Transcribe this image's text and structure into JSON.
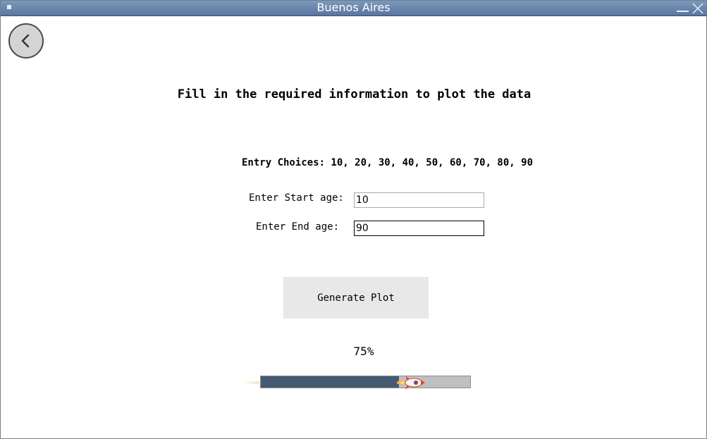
{
  "window": {
    "title": "Buenos Aires"
  },
  "titlebar_icons": [
    "window-menu-icon",
    "minimize-icon",
    "close-icon"
  ],
  "back_button": {
    "icon": "chevron-left-icon"
  },
  "heading": "Fill in the required information to plot the data",
  "choices_text": "Entry Choices: 10, 20, 30, 40, 50, 60, 70, 80, 90",
  "form": {
    "start_label": "Enter Start age:",
    "start_value": "10",
    "end_label": "Enter End age:",
    "end_value": "90"
  },
  "generate_button": "Generate Plot",
  "progress": {
    "text": "75%",
    "value": 0.75,
    "icon": "rocket-icon"
  },
  "colors": {
    "titlebar": "#6a86ad",
    "progress_fill": "#445a72",
    "progress_track": "#c0c0c0",
    "button_bg": "#e8e8e8"
  }
}
